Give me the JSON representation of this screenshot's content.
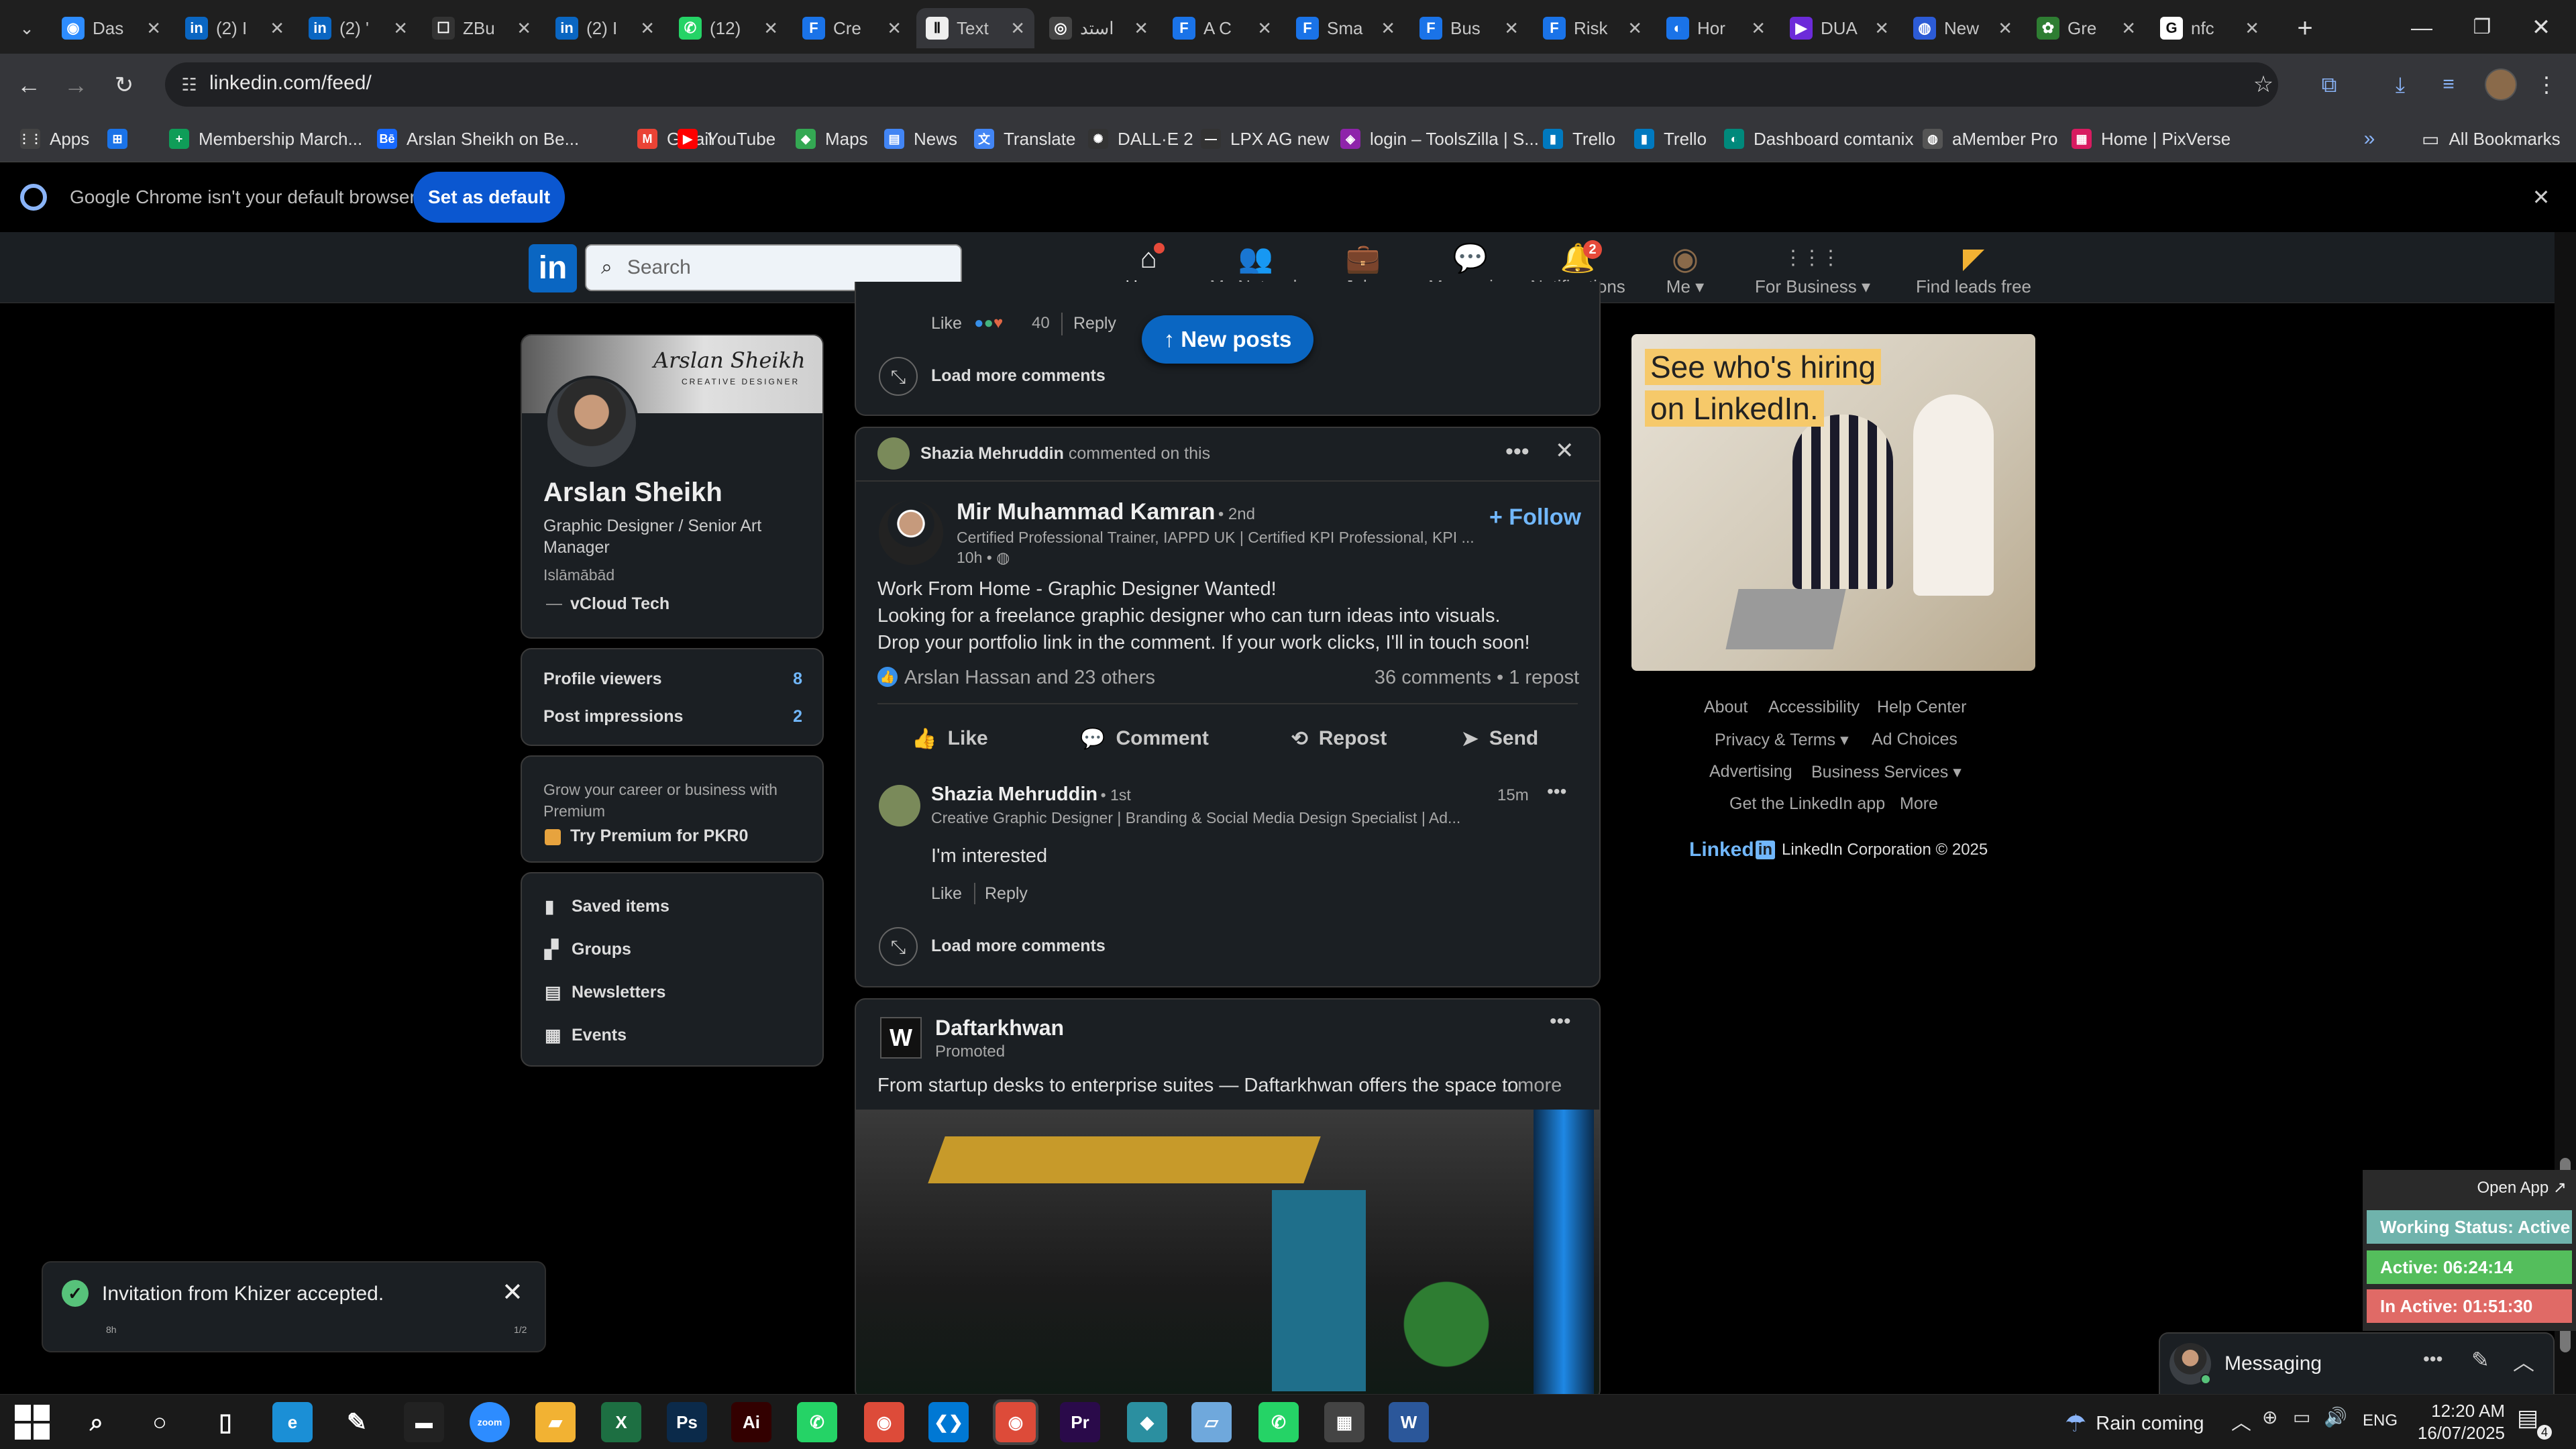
{
  "browser": {
    "tabs": [
      {
        "title": "Das",
        "color": "#2d8cff",
        "glyph": "◉"
      },
      {
        "title": "(2) I",
        "color": "#0a66c2",
        "glyph": "in"
      },
      {
        "title": "(2) '",
        "color": "#0a66c2",
        "glyph": "in"
      },
      {
        "title": "ZBu",
        "color": "#333333",
        "glyph": "☐"
      },
      {
        "title": "(2) I",
        "color": "#0a66c2",
        "glyph": "in"
      },
      {
        "title": "(12)",
        "color": "#25d366",
        "glyph": "✆"
      },
      {
        "title": "Cre",
        "color": "#1a73e8",
        "glyph": "F"
      },
      {
        "title": "Text",
        "color": "#eeeeee",
        "glyph": "Ⅱ"
      },
      {
        "title": "استد",
        "color": "#444444",
        "glyph": "◎"
      },
      {
        "title": "A C",
        "color": "#1a73e8",
        "glyph": "F"
      },
      {
        "title": "Sma",
        "color": "#1a73e8",
        "glyph": "F"
      },
      {
        "title": "Bus",
        "color": "#1a73e8",
        "glyph": "F"
      },
      {
        "title": "Risk",
        "color": "#1a73e8",
        "glyph": "F"
      },
      {
        "title": "Hor",
        "color": "#1a73e8",
        "glyph": "◐"
      },
      {
        "title": "DUA",
        "color": "#6c2bd9",
        "glyph": "▶"
      },
      {
        "title": "New",
        "color": "#2c5bd6",
        "glyph": "◍"
      },
      {
        "title": "Gre",
        "color": "#2e7d32",
        "glyph": "✿"
      },
      {
        "title": "nfc",
        "color": "#ffffff",
        "glyph": "G"
      }
    ],
    "active_tab_index": 7,
    "url": "linkedin.com/feed/",
    "bookmarks": [
      {
        "label": "Apps",
        "icon": "apps-grid-icon",
        "color": "#444444",
        "glyph": "⋮⋮"
      },
      {
        "label": "",
        "icon": "tab-groups-icon",
        "color": "#1a73e8",
        "glyph": "⊞"
      },
      {
        "label": "Membership March...",
        "icon": "sheets-icon",
        "color": "#0f9d58",
        "glyph": "+"
      },
      {
        "label": "Arslan Sheikh on Be...",
        "icon": "behance-icon",
        "color": "#1769ff",
        "glyph": "Bē"
      },
      {
        "label": "Gmail",
        "icon": "gmail-icon",
        "color": "#ea4335",
        "glyph": "M"
      },
      {
        "label": "YouTube",
        "icon": "youtube-icon",
        "color": "#ff0000",
        "glyph": "▶"
      },
      {
        "label": "Maps",
        "icon": "maps-icon",
        "color": "#34a853",
        "glyph": "◆"
      },
      {
        "label": "News",
        "icon": "news-icon",
        "color": "#4285f4",
        "glyph": "▤"
      },
      {
        "label": "Translate",
        "icon": "translate-icon",
        "color": "#4285f4",
        "glyph": "文"
      },
      {
        "label": "DALL·E 2",
        "icon": "openai-icon",
        "color": "#333333",
        "glyph": "✺"
      },
      {
        "label": "LPX AG new",
        "icon": "dash-icon",
        "color": "#333333",
        "glyph": "—"
      },
      {
        "label": "login – ToolsZilla | S...",
        "icon": "toolszilla-icon",
        "color": "#8e24aa",
        "glyph": "◈"
      },
      {
        "label": "Trello",
        "icon": "trello-icon",
        "color": "#0079bf",
        "glyph": "▮"
      },
      {
        "label": "Trello",
        "icon": "trello-icon",
        "color": "#0079bf",
        "glyph": "▮"
      },
      {
        "label": "Dashboard comtanix",
        "icon": "comtanix-icon",
        "color": "#00897b",
        "glyph": "◐"
      },
      {
        "label": "aMember Pro",
        "icon": "amember-icon",
        "color": "#555555",
        "glyph": "◍"
      },
      {
        "label": "Home | PixVerse",
        "icon": "pixverse-icon",
        "color": "#d81b60",
        "glyph": "▦"
      }
    ],
    "all_bookmarks": "All Bookmarks",
    "infobar": {
      "message": "Google Chrome isn't your default browser",
      "button": "Set as default"
    }
  },
  "nav": {
    "search_placeholder": "Search",
    "items": [
      {
        "label": "Home",
        "glyph": "⌂",
        "badge": ""
      },
      {
        "label": "My Network",
        "glyph": "👥",
        "badge": ""
      },
      {
        "label": "Jobs",
        "glyph": "💼",
        "badge": ""
      },
      {
        "label": "Messaging",
        "glyph": "💬",
        "badge": ""
      },
      {
        "label": "Notifications",
        "glyph": "🔔",
        "badge": "2"
      },
      {
        "label": "Me ▾",
        "glyph": "◉",
        "badge": ""
      },
      {
        "label": "For Business ▾",
        "glyph": "⋮⋮⋮",
        "badge": ""
      },
      {
        "label": "Find leads free",
        "glyph": "◤",
        "badge": ""
      }
    ]
  },
  "profile": {
    "banner_name": "Arslan Sheikh",
    "banner_sub": "CREATIVE DESIGNER",
    "name": "Arslan Sheikh",
    "headline_1": "Graphic Designer / Senior Art",
    "headline_2": "Manager",
    "location": "Islāmābād",
    "company": "vCloud Tech",
    "stats": [
      {
        "label": "Profile viewers",
        "value": "8"
      },
      {
        "label": "Post impressions",
        "value": "2"
      }
    ],
    "premium_1": "Grow your career or business with",
    "premium_2": "Premium",
    "premium_cta": "Try Premium for PKR0",
    "links": [
      "Saved items",
      "Groups",
      "Newsletters",
      "Events"
    ]
  },
  "feed": {
    "top": {
      "like": "Like",
      "count": "40",
      "reply": "Reply",
      "load_more": "Load more comments",
      "new_posts": "↑  New posts"
    },
    "post": {
      "commenter": "Shazia Mehruddin",
      "commented": "commented on this",
      "author": "Mir Muhammad Kamran",
      "degree": "• 2nd",
      "author_headline": "Certified Professional Trainer, IAPPD UK | Certified KPI Professional, KPI ...",
      "time": "10h •",
      "follow": "+ Follow",
      "line1": "Work From Home - Graphic Designer Wanted!",
      "line2": "Looking for a freelance graphic designer who can turn ideas into visuals.",
      "line3": "Drop your portfolio link in the comment. If your work clicks, I'll in touch soon!",
      "reactions": "Arslan Hassan and 23 others",
      "comments": "36 comments • 1 repost",
      "actions": [
        "Like",
        "Comment",
        "Repost",
        "Send"
      ],
      "comment": {
        "author": "Shazia Mehruddin",
        "degree": "• 1st",
        "headline": "Creative Graphic Designer | Branding & Social Media Design Specialist | Ad...",
        "time": "15m",
        "text": "I'm interested",
        "like": "Like",
        "reply": "Reply"
      },
      "load_more": "Load more comments"
    },
    "ad": {
      "name": "Daftarkhwan",
      "promoted": "Promoted",
      "text": "From startup desks to enterprise suites — Daftarkhwan offers the space to",
      "more": "...more"
    }
  },
  "right": {
    "ad_line1": "See who's hiring",
    "ad_line2": "on LinkedIn.",
    "footer_rows": [
      [
        "About",
        "Accessibility",
        "Help Center"
      ],
      [
        "Privacy & Terms ▾",
        "Ad Choices"
      ],
      [
        "Advertising",
        "Business Services ▾"
      ],
      [
        "Get the LinkedIn app",
        "More"
      ]
    ],
    "logo": "Linked",
    "copyright": "LinkedIn Corporation © 2025"
  },
  "toast": {
    "text": "Invitation from Khizer accepted.",
    "time": "8h",
    "page": "1/2"
  },
  "tracker": {
    "open": "Open App ↗",
    "status": "Working Status: Active",
    "active": "Active: 06:24:14",
    "inactive": "In Active: 01:51:30"
  },
  "messaging": {
    "label": "Messaging"
  },
  "taskbar": {
    "apps": [
      {
        "name": "search",
        "glyph": "⌕",
        "color": "transparent"
      },
      {
        "name": "cortana",
        "glyph": "○",
        "color": "transparent"
      },
      {
        "name": "task-view",
        "glyph": "▯",
        "color": "transparent"
      },
      {
        "name": "edge",
        "glyph": "e",
        "color": "#1b8fd6"
      },
      {
        "name": "pen",
        "glyph": "✎",
        "color": "transparent"
      },
      {
        "name": "terminal",
        "glyph": "▬",
        "color": "#222222"
      },
      {
        "name": "zoom",
        "glyph": "zoom",
        "color": "#2d8cff"
      },
      {
        "name": "explorer",
        "glyph": "▰",
        "color": "#f2b233"
      },
      {
        "name": "excel",
        "glyph": "X",
        "color": "#1d6f42"
      },
      {
        "name": "photoshop",
        "glyph": "Ps",
        "color": "#0b2a4a"
      },
      {
        "name": "illustrator",
        "glyph": "Ai",
        "color": "#330000"
      },
      {
        "name": "whatsapp",
        "glyph": "✆",
        "color": "#25d366"
      },
      {
        "name": "chrome",
        "glyph": "◉",
        "color": "#dd4b39"
      },
      {
        "name": "vscode",
        "glyph": "❮❯",
        "color": "#0078d4"
      },
      {
        "name": "chrome-active",
        "glyph": "◉",
        "color": "#dd4b39"
      },
      {
        "name": "premiere",
        "glyph": "Pr",
        "color": "#2a0a4a"
      },
      {
        "name": "app-diamond",
        "glyph": "◆",
        "color": "#2b8fa0"
      },
      {
        "name": "app-pen",
        "glyph": "▱",
        "color": "#6fa8dc"
      },
      {
        "name": "whatsapp-2",
        "glyph": "✆",
        "color": "#25d366"
      },
      {
        "name": "calculator",
        "glyph": "▦",
        "color": "#444444"
      },
      {
        "name": "word",
        "glyph": "W",
        "color": "#2b579a"
      }
    ],
    "weather": "Rain coming",
    "lang": "ENG",
    "time": "12:20 AM",
    "date": "16/07/2025",
    "notifications": "4"
  }
}
